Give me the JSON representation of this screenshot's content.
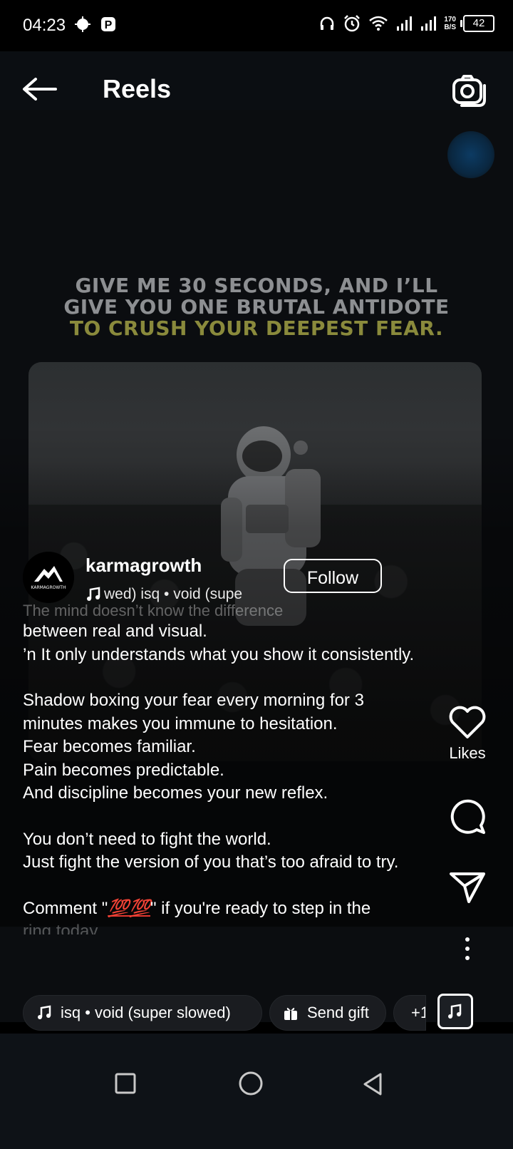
{
  "status_bar": {
    "time": "04:23",
    "net_speed_value": "170",
    "net_speed_unit": "B/S",
    "battery": "42",
    "icons": [
      "android-icon",
      "parking-icon",
      "headset-icon",
      "alarm-icon",
      "wifi-icon",
      "signal-icon",
      "signal-icon-2"
    ]
  },
  "header": {
    "title": "Reels",
    "back_icon": "arrow-left-icon",
    "camera_icon": "camera-icon"
  },
  "video": {
    "headline_line1": "GIVE ME 30 SECONDS, AND I’LL",
    "headline_line2": "GIVE YOU ONE BRUTAL ANTIDOTE",
    "headline_line3": "TO CRUSH YOUR DEEPEST FEAR.",
    "headline_colors": {
      "primary": "#8d8f92",
      "accent": "#8a8a3c"
    }
  },
  "author": {
    "username": "karmagrowth",
    "avatar_text": "KARMAGROWTH",
    "audio_text": "wed)    isq • void (supe",
    "follow_label": "Follow"
  },
  "caption": {
    "faded_top": "  The mind doesn’t know the difference",
    "p1": "between real and visual.\n’n It only understands what you show it consistently.",
    "p2": "Shadow boxing your fear every morning for 3 minutes makes you immune to hesitation.\nFear becomes familiar.\nPain becomes predictable.\nAnd discipline becomes your new reflex.",
    "p3": "You don’t need to fight the world.\nJust fight the version of you that’s too afraid to try.",
    "p4_before": "Comment \"",
    "p4_emoji": "💯💯",
    "p4_after": "\" if you're ready to step in the",
    "tail": "ring today"
  },
  "side_actions": {
    "likes_label": "Likes",
    "icons": [
      "heart-icon",
      "comment-icon",
      "share-icon",
      "more-icon",
      "audio-thumbnail-icon"
    ]
  },
  "bottom_chips": {
    "audio_label": "isq • void (super slowed)",
    "gift_label": "Send gift",
    "more_label": "+1"
  },
  "nav": {
    "icons": [
      "recents-square-icon",
      "home-circle-icon",
      "back-triangle-icon"
    ]
  }
}
